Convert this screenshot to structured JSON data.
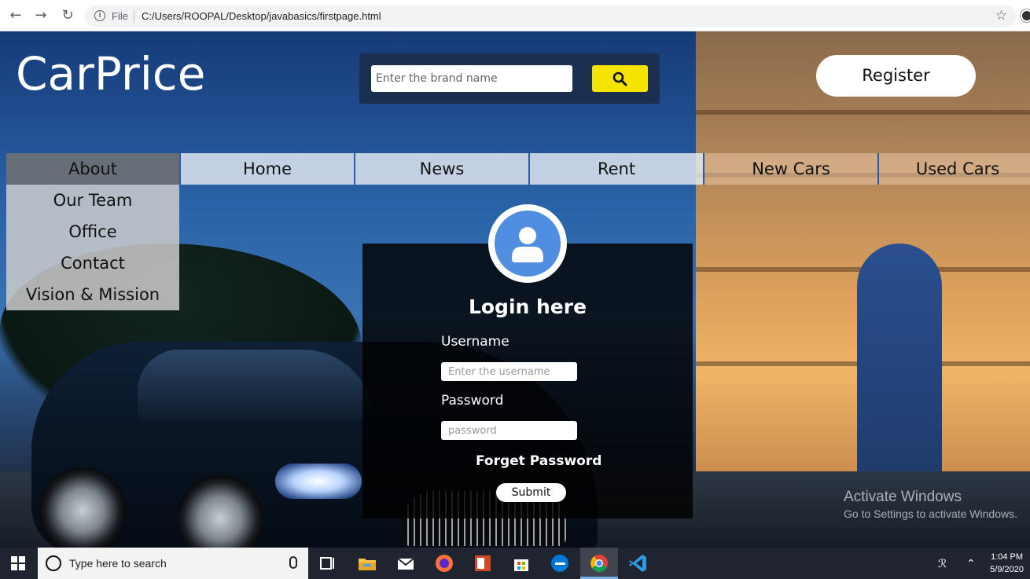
{
  "browser": {
    "back_icon": "arrow-left-icon",
    "forward_icon": "arrow-right-icon",
    "reload_icon": "reload-icon",
    "scheme_label": "File",
    "url": "C:/Users/ROOPAL/Desktop/javabasics/firstpage.html",
    "bookmark_icon": "star-icon"
  },
  "header": {
    "logo": "CarPrice",
    "search_placeholder": "Enter the brand name",
    "search_button_icon": "search-icon",
    "search_button_color": "#f5e400",
    "register_label": "Register"
  },
  "menu": {
    "items": [
      {
        "label": "About"
      },
      {
        "label": "Home"
      },
      {
        "label": "News"
      },
      {
        "label": "Rent"
      },
      {
        "label": "New Cars"
      },
      {
        "label": "Used Cars"
      }
    ],
    "dropdown": [
      {
        "label": "Our Team"
      },
      {
        "label": "Office"
      },
      {
        "label": "Contact"
      },
      {
        "label": "Vision & Mission"
      }
    ]
  },
  "login": {
    "avatar_icon": "user-avatar-icon",
    "title": "Login here",
    "username_label": "Username",
    "username_placeholder": "Enter the username",
    "password_label": "Password",
    "password_placeholder": "password",
    "forget_label": "Forget Password",
    "submit_label": "Submit"
  },
  "watermark": {
    "line1": "Activate Windows",
    "line2": "Go to Settings to activate Windows."
  },
  "taskbar": {
    "search_text": "Type here to search",
    "time": "1:04 PM",
    "date": "5/9/2020"
  }
}
